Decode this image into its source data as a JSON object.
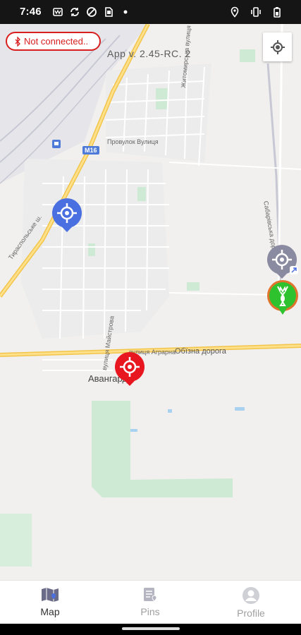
{
  "status_bar": {
    "time": "7:46",
    "left_icons": [
      "sim-icon",
      "sync-icon",
      "data-saver-icon",
      "sd-card-icon",
      "dot-icon"
    ],
    "right_icons": [
      "location-icon",
      "vibrate-icon",
      "battery-icon"
    ]
  },
  "connection": {
    "label": "Not connected..",
    "color": "#d81e1e"
  },
  "app": {
    "version": "App v. 2.45-RC. 2"
  },
  "map": {
    "labels": {
      "road_m16": "M16",
      "street_1": "Тираспольське ш.",
      "street_2": "Провулок Вулиця",
      "street_3": "Житомирська вулиця",
      "street_4": "Обїзна дорога",
      "street_5": "вулиця Аграрна",
      "street_6": "вулиця Майстрова",
      "street_7": "Сабарівська дорога",
      "town": "Авангард"
    },
    "pins": [
      {
        "name": "blue-pin",
        "color": "#4a6fe0"
      },
      {
        "name": "red-pin",
        "color": "#e8171f"
      },
      {
        "name": "gray-pin",
        "color": "#8a8aa0"
      },
      {
        "name": "deer-pin",
        "color": "#2ec22e"
      }
    ]
  },
  "nav": {
    "items": [
      {
        "label": "Map",
        "icon": "map-icon",
        "active": true
      },
      {
        "label": "Pins",
        "icon": "pins-icon",
        "active": false
      },
      {
        "label": "Profile",
        "icon": "profile-icon",
        "active": false
      }
    ]
  }
}
